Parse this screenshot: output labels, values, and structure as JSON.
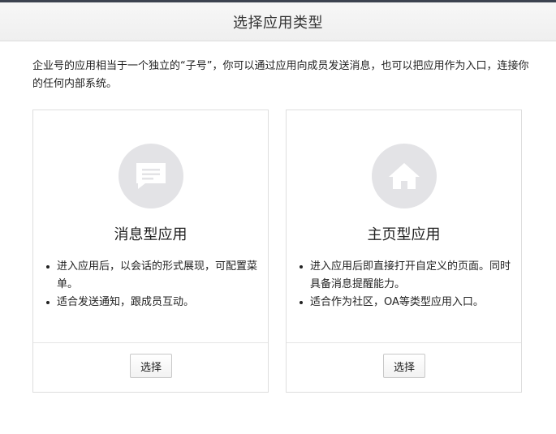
{
  "header": {
    "title": "选择应用类型"
  },
  "intro": {
    "text": "企业号的应用相当于一个独立的“子号”，你可以通过应用向成员发送消息，也可以把应用作为入口，连接你的任何内部系统。"
  },
  "cards": [
    {
      "icon": "chat-message-icon",
      "title": "消息型应用",
      "bullets": [
        "进入应用后，以会话的形式展现，可配置菜单。",
        "适合发送通知，跟成员互动。"
      ],
      "button_label": "选择"
    },
    {
      "icon": "home-icon",
      "title": "主页型应用",
      "bullets": [
        "进入应用后即直接打开自定义的页面。同时具备消息提醒能力。",
        "适合作为社区，OA等类型应用入口。"
      ],
      "button_label": "选择"
    }
  ],
  "colors": {
    "top_strip": "#3c4350",
    "icon_circle": "#e3e3e6",
    "card_border": "#dedede"
  }
}
